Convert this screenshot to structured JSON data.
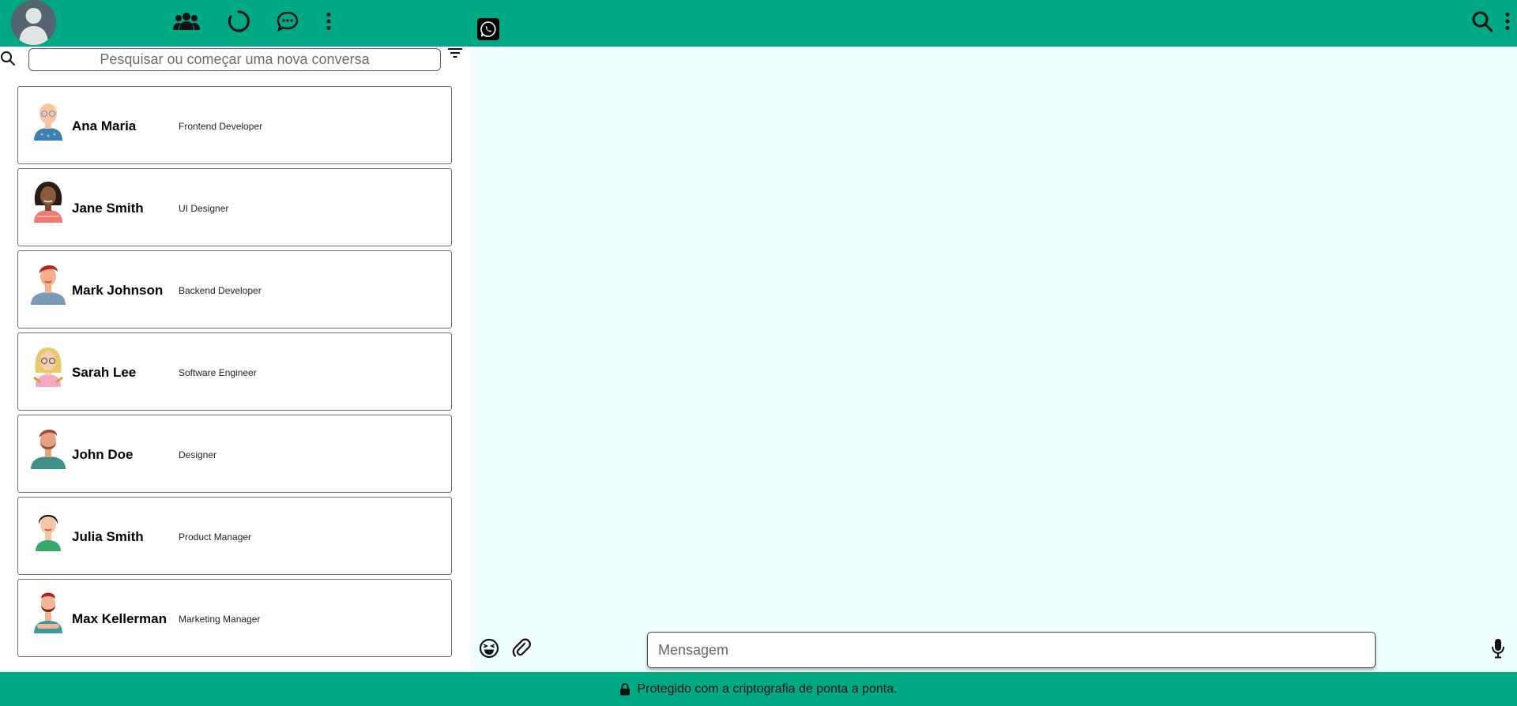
{
  "header": {
    "profile_avatar": "user-avatar-placeholder",
    "icons": [
      "community-icon",
      "status-icon",
      "new-chat-icon",
      "menu-icon"
    ],
    "brand_icon": "whatsapp-icon",
    "right_icons": [
      "search-icon",
      "menu-icon"
    ]
  },
  "search": {
    "placeholder": "Pesquisar ou começar uma nova conversa",
    "value": ""
  },
  "contacts": [
    {
      "name": "Ana Maria",
      "role": "Frontend Developer",
      "avatar": "blonde-woman-glasses"
    },
    {
      "name": "Jane Smith",
      "role": "UI Designer",
      "avatar": "woman-dark-hair"
    },
    {
      "name": "Mark Johnson",
      "role": "Backend Developer",
      "avatar": "man-red-hair"
    },
    {
      "name": "Sarah Lee",
      "role": "Software Engineer",
      "avatar": "blonde-woman-glasses"
    },
    {
      "name": "John Doe",
      "role": "Designer",
      "avatar": "man-beard"
    },
    {
      "name": "Julia Smith",
      "role": "Product Manager",
      "avatar": "woman-black-hair"
    },
    {
      "name": "Max Kellerman",
      "role": "Marketing Manager",
      "avatar": "man-beard-arms-crossed"
    }
  ],
  "composer": {
    "placeholder": "Mensagem",
    "value": ""
  },
  "footer": {
    "text": "Protegido com a criptografia de ponta a ponta."
  },
  "colors": {
    "brand": "#00a884",
    "chat_background": "#efffff"
  }
}
